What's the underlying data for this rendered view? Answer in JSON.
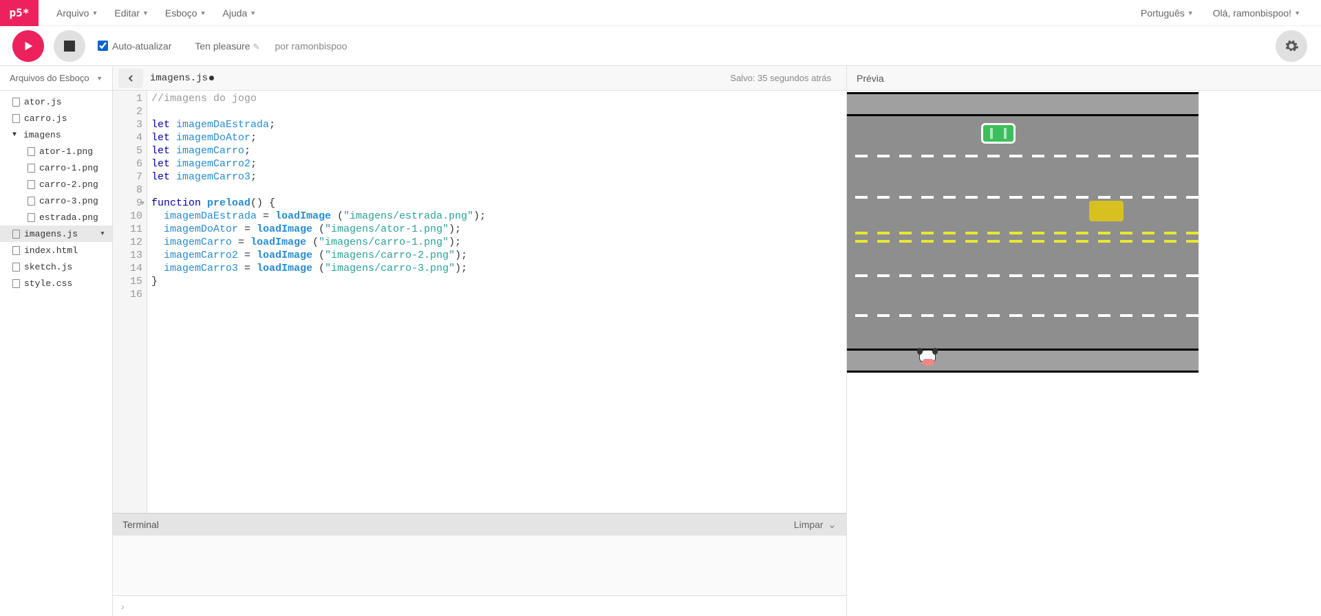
{
  "logo_text": "p5*",
  "menu": {
    "arquivo": "Arquivo",
    "editar": "Editar",
    "esboco": "Esboço",
    "ajuda": "Ajuda",
    "lang": "Português",
    "greeting": "Olá, ramonbispoo!"
  },
  "toolbar": {
    "auto_label": "Auto-atualizar",
    "project": "Ten pleasure",
    "author": "por ramonbispoo"
  },
  "sidebar": {
    "header": "Arquivos do Esboço",
    "files": [
      {
        "name": "ator.js",
        "type": "file",
        "nested": false
      },
      {
        "name": "carro.js",
        "type": "file",
        "nested": false
      },
      {
        "name": "imagens",
        "type": "folder",
        "nested": false
      },
      {
        "name": "ator-1.png",
        "type": "file",
        "nested": true
      },
      {
        "name": "carro-1.png",
        "type": "file",
        "nested": true
      },
      {
        "name": "carro-2.png",
        "type": "file",
        "nested": true
      },
      {
        "name": "carro-3.png",
        "type": "file",
        "nested": true
      },
      {
        "name": "estrada.png",
        "type": "file",
        "nested": true
      },
      {
        "name": "imagens.js",
        "type": "file",
        "nested": false,
        "selected": true
      },
      {
        "name": "index.html",
        "type": "file",
        "nested": false
      },
      {
        "name": "sketch.js",
        "type": "file",
        "nested": false
      },
      {
        "name": "style.css",
        "type": "file",
        "nested": false
      }
    ]
  },
  "editor": {
    "tab_name": "imagens.js",
    "save_status": "Salvo: 35 segundos atrás",
    "lines": 16
  },
  "code": {
    "l1_comment": "//imagens do jogo",
    "let": "let",
    "v1": "imagemDaEstrada",
    "v2": "imagemDoAtor",
    "v3": "imagemCarro",
    "v4": "imagemCarro2",
    "v5": "imagemCarro3",
    "fn_kw": "function",
    "preload": "preload",
    "loadImage": "loadImage",
    "s1": "\"imagens/estrada.png\"",
    "s2": "\"imagens/ator-1.png\"",
    "s3": "\"imagens/carro-1.png\"",
    "s4": "\"imagens/carro-2.png\"",
    "s5": "\"imagens/carro-3.png\""
  },
  "terminal": {
    "label": "Terminal",
    "clear": "Limpar"
  },
  "preview": {
    "label": "Prévia"
  }
}
